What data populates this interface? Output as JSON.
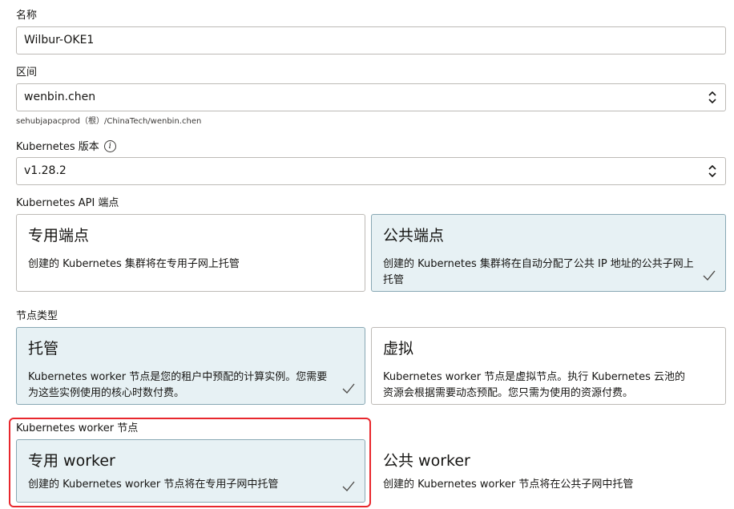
{
  "name_field": {
    "label": "名称",
    "value": "Wilbur-OKE1"
  },
  "compartment_field": {
    "label": "区间",
    "value": "wenbin.chen",
    "helper": "sehubjapacprod（根）/ChinaTech/wenbin.chen"
  },
  "version_field": {
    "label": "Kubernetes 版本",
    "value": "v1.28.2",
    "info_icon": "i"
  },
  "api_endpoint": {
    "label": "Kubernetes API 端点",
    "options": [
      {
        "title": "专用端点",
        "desc": "创建的 Kubernetes 集群将在专用子网上托管"
      },
      {
        "title": "公共端点",
        "desc": "创建的 Kubernetes 集群将在自动分配了公共 IP 地址的公共子网上托管"
      }
    ]
  },
  "node_type": {
    "label": "节点类型",
    "options": [
      {
        "title": "托管",
        "desc": "Kubernetes worker 节点是您的租户中预配的计算实例。您需要为这些实例使用的核心时数付费。"
      },
      {
        "title": "虚拟",
        "desc": "Kubernetes worker 节点是虚拟节点。执行 Kubernetes 云池的资源会根据需要动态预配。您只需为使用的资源付费。"
      }
    ]
  },
  "worker_nodes": {
    "label": "Kubernetes worker 节点",
    "options": [
      {
        "title": "专用 worker",
        "desc": "创建的 Kubernetes worker 节点将在专用子网中托管"
      },
      {
        "title": "公共 worker",
        "desc": "创建的 Kubernetes worker 节点将在公共子网中托管"
      }
    ]
  },
  "colors": {
    "selected_bg": "#e7f1f4",
    "border": "#bdbab6",
    "highlight": "#e8272d"
  },
  "icons": {
    "select": "chevron-up-down-icon",
    "check": "checkmark-icon",
    "info": "info-icon"
  }
}
